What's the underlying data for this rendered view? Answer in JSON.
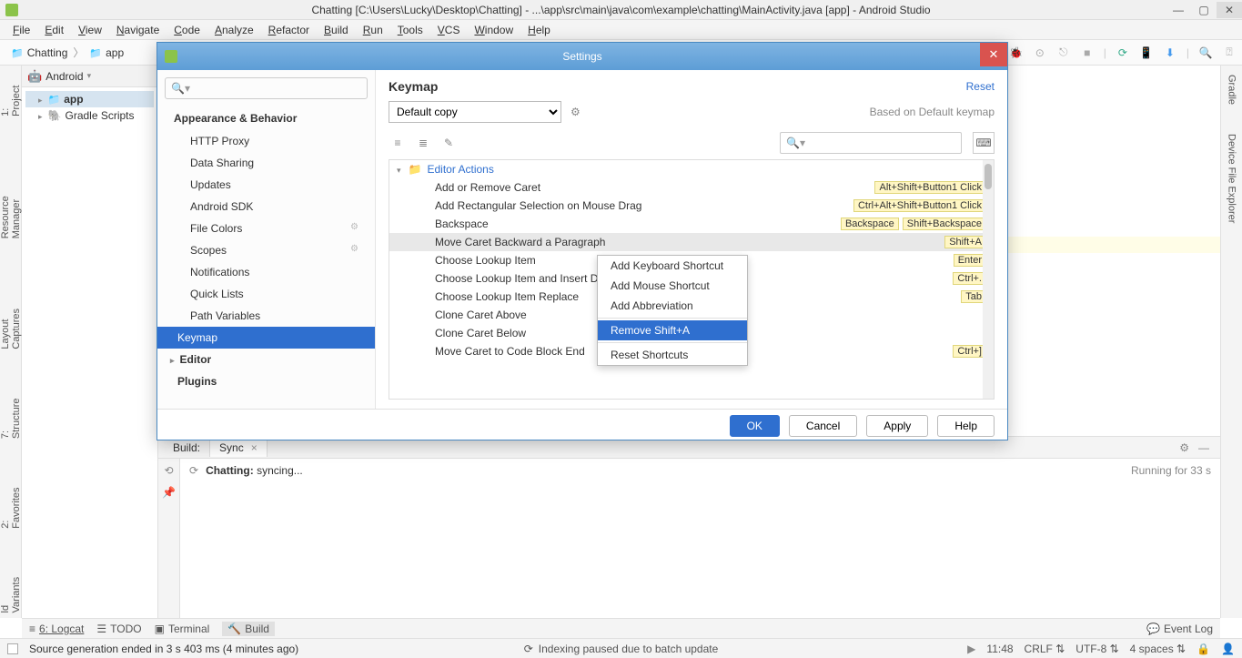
{
  "window": {
    "title": "Chatting [C:\\Users\\Lucky\\Desktop\\Chatting] - ...\\app\\src\\main\\java\\com\\example\\chatting\\MainActivity.java [app] - Android Studio"
  },
  "menu": [
    "File",
    "Edit",
    "View",
    "Navigate",
    "Code",
    "Analyze",
    "Refactor",
    "Build",
    "Run",
    "Tools",
    "VCS",
    "Window",
    "Help"
  ],
  "breadcrumb": {
    "a": "Chatting",
    "b": "app"
  },
  "project": {
    "mode": "Android",
    "items": [
      {
        "label": "app",
        "icon": "folder"
      },
      {
        "label": "Gradle Scripts",
        "icon": "elephant"
      }
    ]
  },
  "side_left": [
    "1: Project",
    "Resource Manager",
    "Layout Captures",
    "7: Structure",
    "2: Favorites",
    "ld Variants"
  ],
  "side_right": [
    "Gradle",
    "Device File Explorer"
  ],
  "dialog": {
    "title": "Settings",
    "nav": {
      "group1": "Appearance & Behavior",
      "items1": [
        "HTTP Proxy",
        "Data Sharing",
        "Updates",
        "Android SDK",
        "File Colors",
        "Scopes",
        "Notifications",
        "Quick Lists",
        "Path Variables"
      ],
      "selected": "Keymap",
      "editor": "Editor",
      "plugins": "Plugins"
    },
    "content": {
      "title": "Keymap",
      "reset": "Reset",
      "scheme": "Default copy",
      "based": "Based on Default keymap",
      "tree_header": "Editor Actions",
      "rows": [
        {
          "label": "Add or Remove Caret",
          "sc": [
            "Alt+Shift+Button1 Click"
          ]
        },
        {
          "label": "Add Rectangular Selection on Mouse Drag",
          "sc": [
            "Ctrl+Alt+Shift+Button1 Click"
          ]
        },
        {
          "label": "Backspace",
          "sc": [
            "Backspace",
            "Shift+Backspace"
          ]
        },
        {
          "label": "Move Caret Backward a Paragraph",
          "sc": [
            "Shift+A"
          ],
          "selected": true
        },
        {
          "label": "Choose Lookup Item",
          "sc": [
            "Enter"
          ]
        },
        {
          "label": "Choose Lookup Item and Insert Dot",
          "sc": [
            "Ctrl+."
          ]
        },
        {
          "label": "Choose Lookup Item Replace",
          "sc": [
            "Tab"
          ]
        },
        {
          "label": "Clone Caret Above",
          "sc": []
        },
        {
          "label": "Clone Caret Below",
          "sc": []
        },
        {
          "label": "Move Caret to Code Block End",
          "sc": [
            "Ctrl+]"
          ]
        }
      ]
    },
    "buttons": {
      "ok": "OK",
      "cancel": "Cancel",
      "apply": "Apply",
      "help": "Help"
    }
  },
  "context_menu": {
    "items": [
      "Add Keyboard Shortcut",
      "Add Mouse Shortcut",
      "Add Abbreviation"
    ],
    "selected": "Remove Shift+A",
    "last": "Reset Shortcuts"
  },
  "bottom": {
    "tabs": {
      "build": "Build:",
      "sync": "Sync"
    },
    "status_title": "Chatting:",
    "status_text": "syncing...",
    "running": "Running for 33 s"
  },
  "toolwin": {
    "logcat": "6: Logcat",
    "todo": "TODO",
    "terminal": "Terminal",
    "build": "Build",
    "event": "Event Log"
  },
  "status": {
    "left": "Source generation ended in 3 s 403 ms (4 minutes ago)",
    "center": "Indexing paused due to batch update",
    "pos": "11:48",
    "eol": "CRLF",
    "enc": "UTF-8",
    "indent": "4 spaces"
  }
}
